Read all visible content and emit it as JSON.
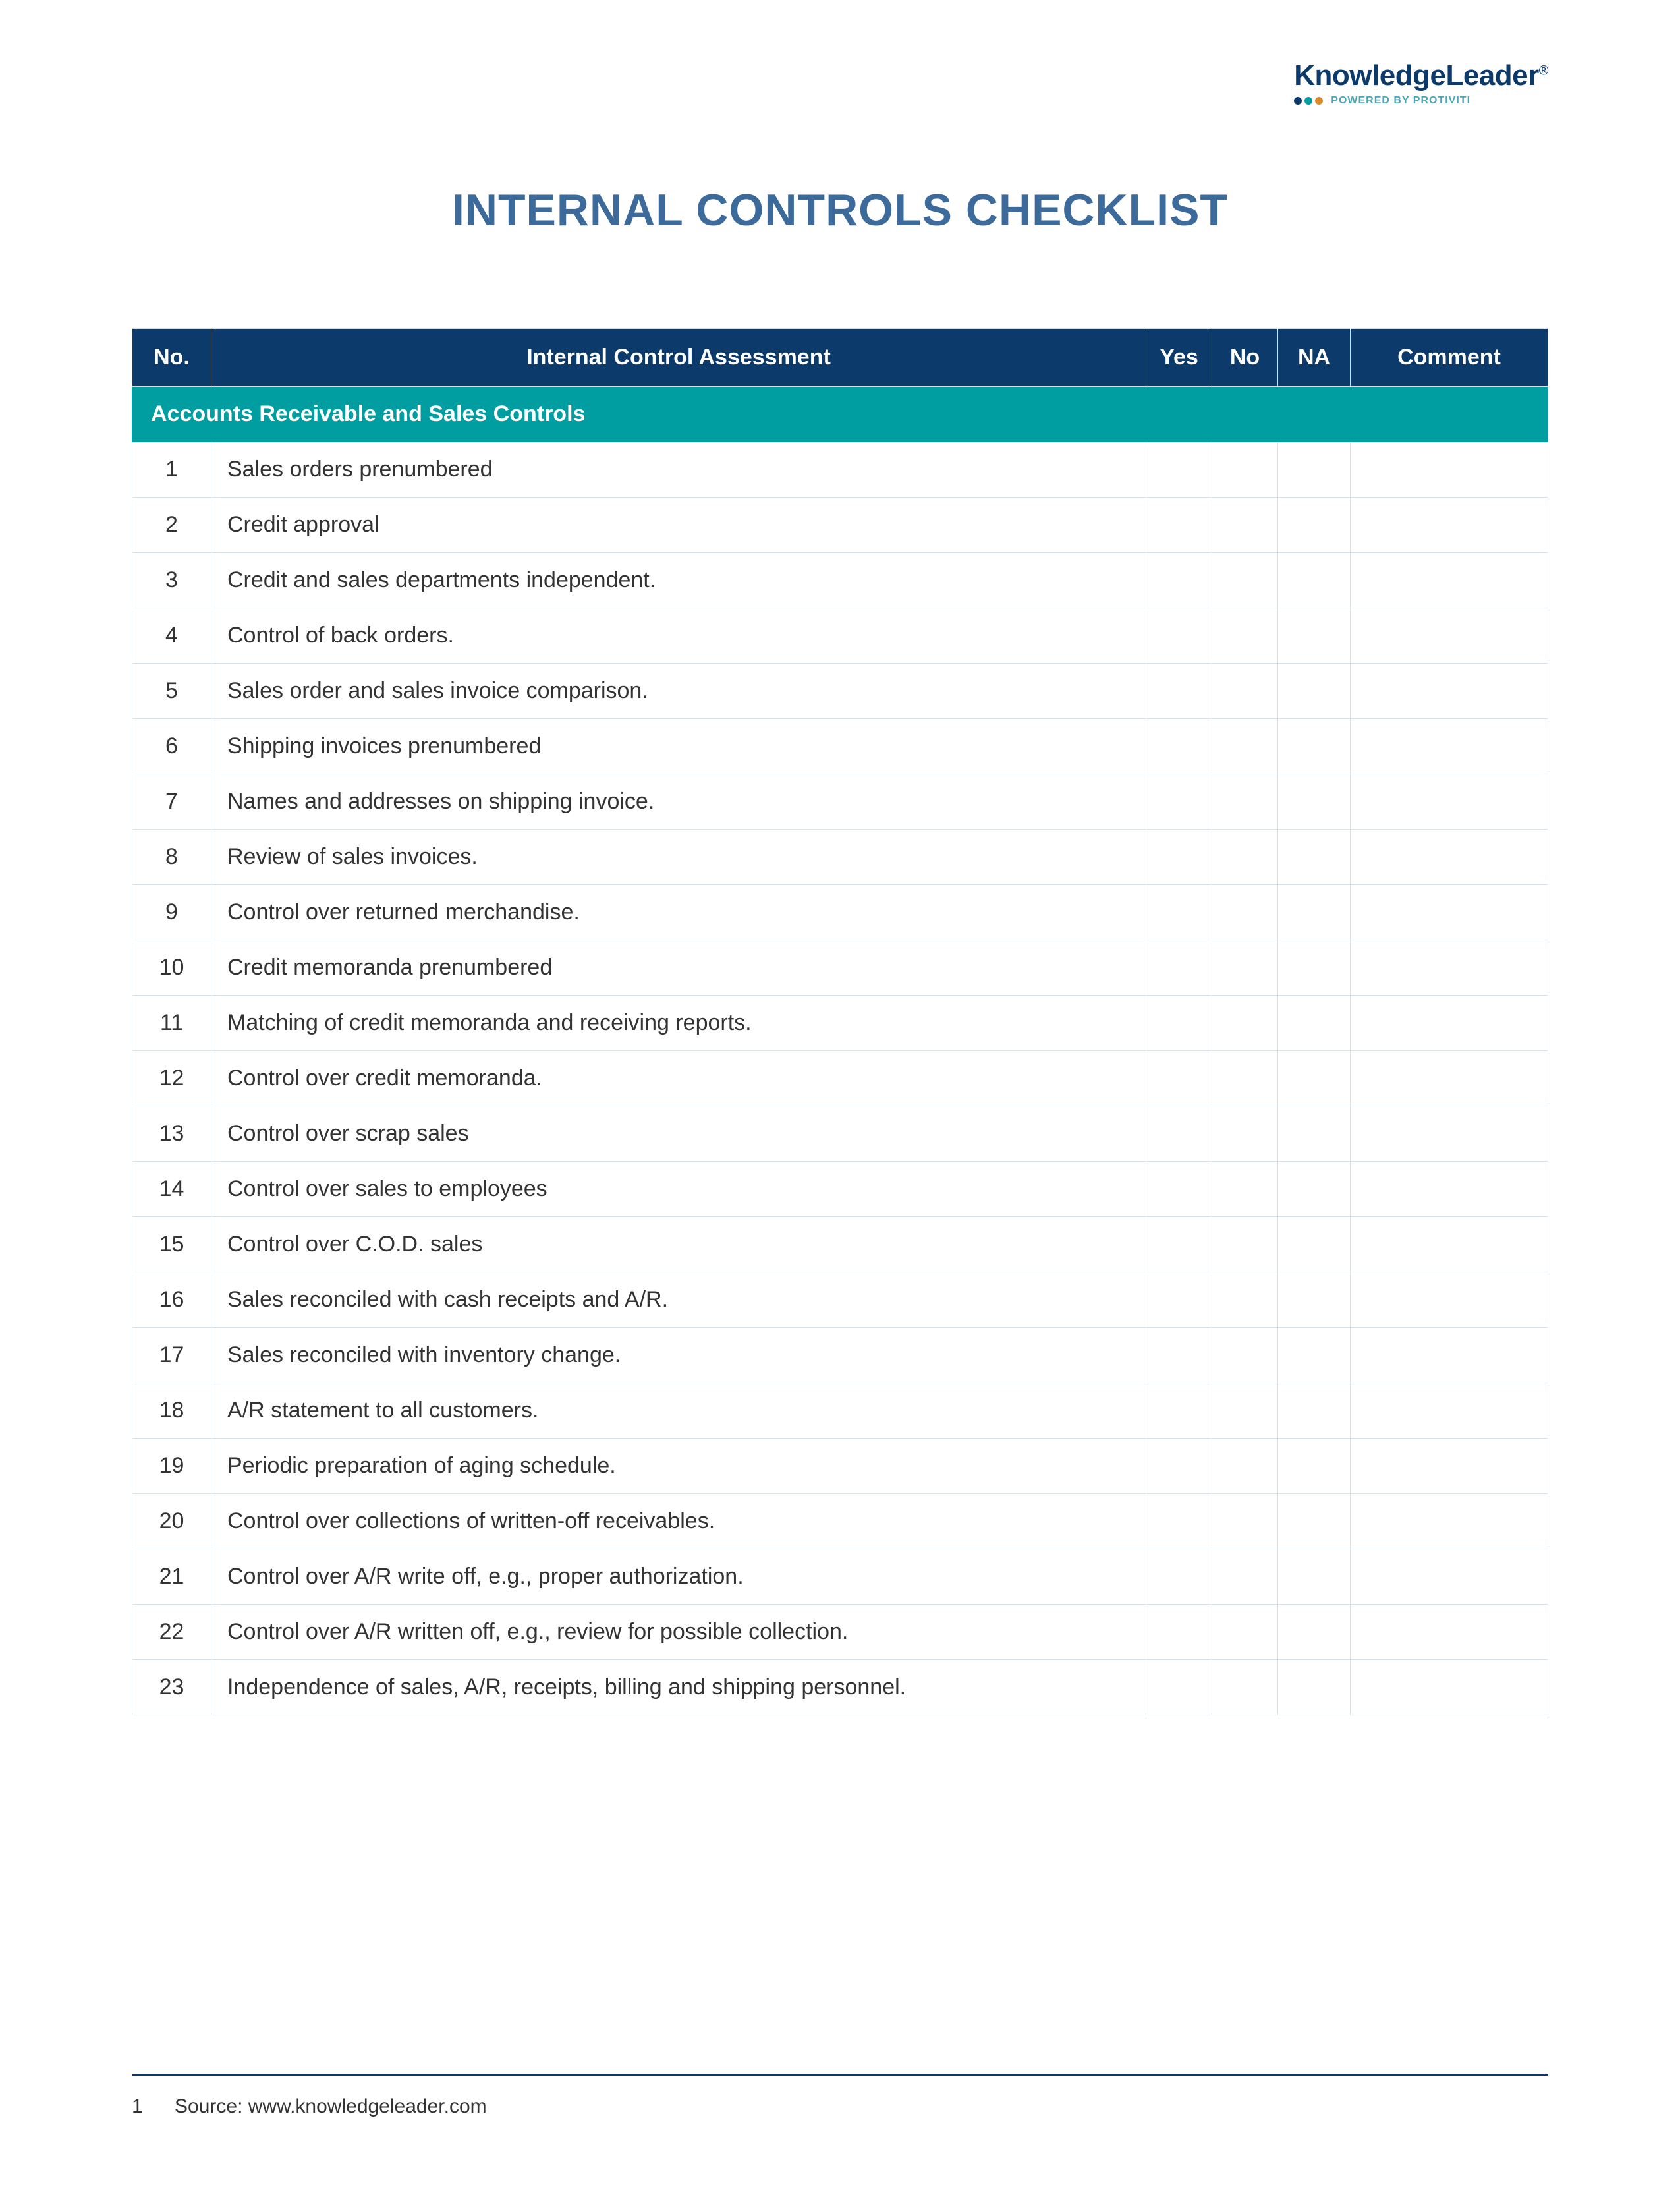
{
  "logo": {
    "main": "KnowledgeLeader",
    "reg": "®",
    "powered": "POWERED BY PROTIVITI"
  },
  "title": "INTERNAL CONTROLS CHECKLIST",
  "headers": {
    "no": "No.",
    "assessment": "Internal Control Assessment",
    "yes": "Yes",
    "no_col": "No",
    "na": "NA",
    "comment": "Comment"
  },
  "section": "Accounts Receivable and Sales Controls",
  "rows": [
    {
      "n": "1",
      "t": "Sales orders prenumbered"
    },
    {
      "n": "2",
      "t": "Credit approval"
    },
    {
      "n": "3",
      "t": "Credit and sales departments independent."
    },
    {
      "n": "4",
      "t": "Control of back orders."
    },
    {
      "n": "5",
      "t": "Sales order and sales invoice comparison."
    },
    {
      "n": "6",
      "t": "Shipping invoices prenumbered"
    },
    {
      "n": "7",
      "t": "Names and addresses on shipping invoice."
    },
    {
      "n": "8",
      "t": "Review of sales invoices."
    },
    {
      "n": "9",
      "t": "Control over returned merchandise."
    },
    {
      "n": "10",
      "t": "Credit memoranda prenumbered"
    },
    {
      "n": "11",
      "t": "Matching of credit memoranda and receiving reports."
    },
    {
      "n": "12",
      "t": "Control over credit memoranda."
    },
    {
      "n": "13",
      "t": "Control over scrap sales"
    },
    {
      "n": "14",
      "t": "Control over sales to employees"
    },
    {
      "n": "15",
      "t": "Control over C.O.D. sales"
    },
    {
      "n": "16",
      "t": "Sales reconciled with cash receipts and A/R."
    },
    {
      "n": "17",
      "t": "Sales reconciled with inventory change."
    },
    {
      "n": "18",
      "t": "A/R statement to all customers."
    },
    {
      "n": "19",
      "t": "Periodic preparation of aging schedule."
    },
    {
      "n": "20",
      "t": "Control over collections of written-off receivables."
    },
    {
      "n": "21",
      "t": "Control over A/R write off, e.g., proper authorization."
    },
    {
      "n": "22",
      "t": "Control over A/R written off, e.g., review for possible collection."
    },
    {
      "n": "23",
      "t": "Independence of sales, A/R, receipts, billing and shipping personnel."
    }
  ],
  "footer": {
    "page": "1",
    "source": "Source: www.knowledgeleader.com"
  }
}
